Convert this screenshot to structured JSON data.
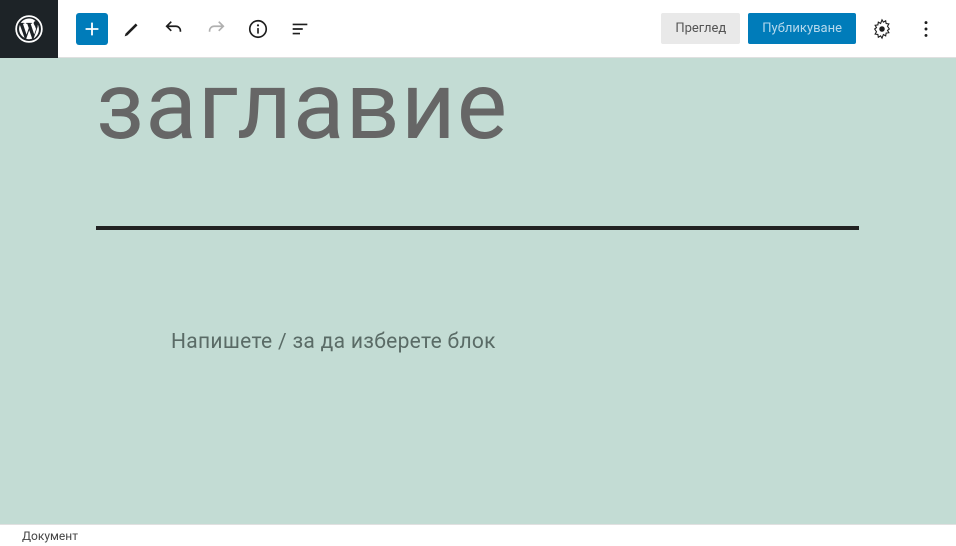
{
  "toolbar": {
    "preview_label": "Преглед",
    "publish_label": "Публикуване"
  },
  "editor": {
    "title_placeholder": "заглавие",
    "body_placeholder": "Напишете / за да изберете блок"
  },
  "footer": {
    "breadcrumb": "Документ"
  }
}
